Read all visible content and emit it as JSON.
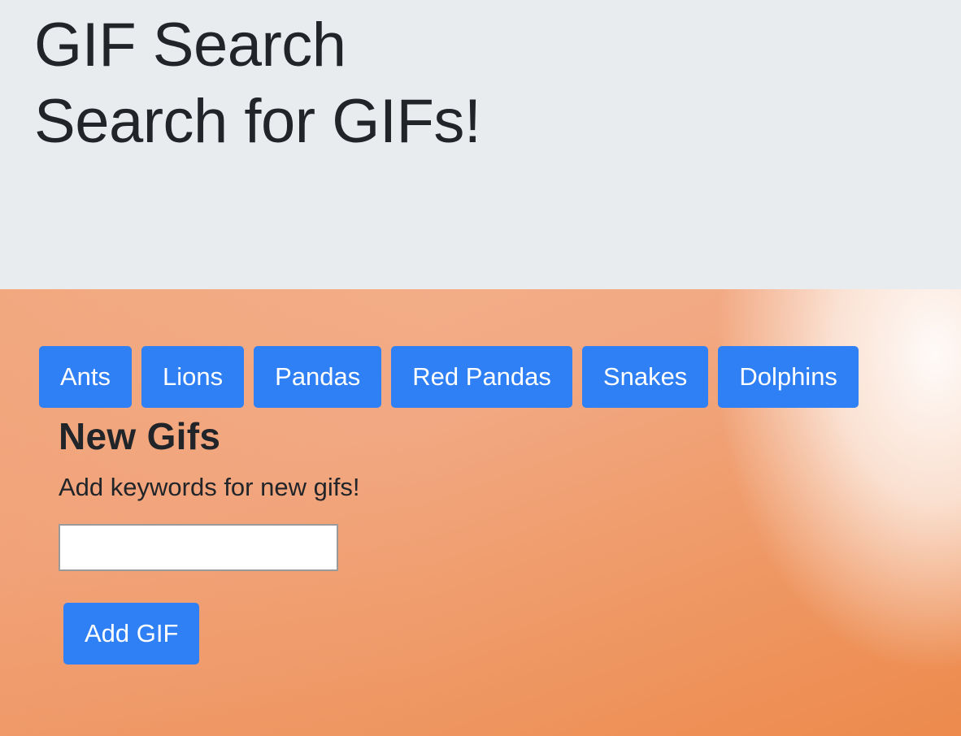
{
  "header": {
    "title": "GIF Search",
    "subtitle": "Search for GIFs!"
  },
  "topics": [
    {
      "label": "Ants"
    },
    {
      "label": "Lions"
    },
    {
      "label": "Pandas"
    },
    {
      "label": "Red Pandas"
    },
    {
      "label": "Snakes"
    },
    {
      "label": "Dolphins"
    }
  ],
  "form": {
    "heading": "New Gifs",
    "instruction": "Add keywords for new gifs!",
    "input_value": "",
    "add_label": "Add GIF"
  },
  "colors": {
    "header_bg": "#e9ecef",
    "button_bg": "#2f7ff5",
    "text": "#212529"
  }
}
